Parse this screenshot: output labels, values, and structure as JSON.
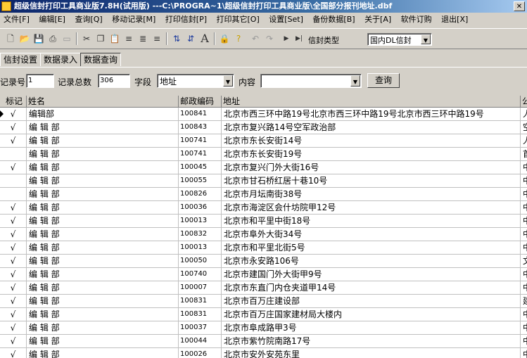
{
  "window": {
    "title": "超级信封打印工具商业版7.8H(试用版)  ---C:\\PROGRA~1\\超级信封打印工具商业版\\全国部分报刊地址.dbf"
  },
  "menu": [
    "文件[F]",
    "编辑[E]",
    "查询[Q]",
    "移动记录[M]",
    "打印信封[P]",
    "打印其它[O]",
    "设置[Set]",
    "备份数据[B]",
    "关于[A]",
    "软件订购",
    "退出[X]"
  ],
  "toolbar": {
    "icons": [
      "new-icon",
      "open-icon",
      "save-icon",
      "print-icon",
      "preview-icon",
      "cut-icon",
      "copy-icon",
      "paste-icon",
      "align-left-icon",
      "align-center-icon",
      "align-right-icon",
      "sort-asc-icon",
      "sort-desc-icon",
      "font-icon",
      "lock-icon",
      "help-icon",
      "undo-icon",
      "redo-icon",
      "next-record-icon",
      "last-record-icon"
    ],
    "envelope_type_label": "信封类型",
    "envelope_type_value": "国内DL信封"
  },
  "tabs": [
    {
      "label": "信封设置",
      "active": false
    },
    {
      "label": "数据录入",
      "active": false
    },
    {
      "label": "数据查询",
      "active": true
    }
  ],
  "filter": {
    "record_no_label": "记录号",
    "record_no_value": "1",
    "record_total_label": "记录总数",
    "record_total_value": "306",
    "field_label": "字段",
    "field_value": "地址",
    "content_label": "内容",
    "content_value": "",
    "query_button": "查询"
  },
  "table": {
    "columns": [
      "标记",
      "姓名",
      "邮政编码",
      "地址",
      "公"
    ],
    "rows": [
      {
        "mark": "√",
        "name": "编辑部",
        "postcode": "100841",
        "address": "北京市西三环中路19号北京市西三环中路19号北京市西三环中路19号",
        "extra": "人"
      },
      {
        "mark": "√",
        "name": "编 辑 部",
        "postcode": "100843",
        "address": "北京市复兴路14号空军政治部",
        "extra": "空"
      },
      {
        "mark": "√",
        "name": "编 辑 部",
        "postcode": "100741",
        "address": "北京市东长安街14号",
        "extra": "人"
      },
      {
        "mark": "",
        "name": "编 辑 部",
        "postcode": "100741",
        "address": "北京市东长安街19号",
        "extra": "首"
      },
      {
        "mark": "√",
        "name": "编 辑 部",
        "postcode": "100045",
        "address": "北京市复兴门外大街16号",
        "extra": "中"
      },
      {
        "mark": "",
        "name": "编 辑 部",
        "postcode": "100055",
        "address": "北京市甘石桥红居十巷10号",
        "extra": "中"
      },
      {
        "mark": "",
        "name": "编 辑 部",
        "postcode": "100826",
        "address": "北京市月坛南街38号",
        "extra": "中"
      },
      {
        "mark": "√",
        "name": "编 辑 部",
        "postcode": "100036",
        "address": "北京市海淀区会什坊院甲12号",
        "extra": "中"
      },
      {
        "mark": "√",
        "name": "编 辑 部",
        "postcode": "100013",
        "address": "北京市和平里中街18号",
        "extra": "中"
      },
      {
        "mark": "√",
        "name": "编 辑 部",
        "postcode": "100832",
        "address": "北京市阜外大街34号",
        "extra": "中"
      },
      {
        "mark": "√",
        "name": "编 辑 部",
        "postcode": "100013",
        "address": "北京市和平里北街5号",
        "extra": "中"
      },
      {
        "mark": "√",
        "name": "编 辑 部",
        "postcode": "100050",
        "address": "北京市永安路106号",
        "extra": "文"
      },
      {
        "mark": "√",
        "name": "编 辑 部",
        "postcode": "100740",
        "address": "北京市建国门外大街甲9号",
        "extra": "中"
      },
      {
        "mark": "√",
        "name": "编 辑 部",
        "postcode": "100007",
        "address": "北京市东直门内仓夹道甲14号",
        "extra": "中"
      },
      {
        "mark": "√",
        "name": "编 辑 部",
        "postcode": "100831",
        "address": "北京市百万庄建设部",
        "extra": "建"
      },
      {
        "mark": "√",
        "name": "编 辑 部",
        "postcode": "100831",
        "address": "北京市百万庄国家建材局大楼内",
        "extra": "中"
      },
      {
        "mark": "√",
        "name": "编 辑 部",
        "postcode": "100037",
        "address": "北京市阜成路甲3号",
        "extra": "中"
      },
      {
        "mark": "√",
        "name": "编 辑 部",
        "postcode": "100044",
        "address": "北京市紫竹院南路17号",
        "extra": "中"
      },
      {
        "mark": "√",
        "name": "编 辑 部",
        "postcode": "100026",
        "address": "北京市安外安苑东里",
        "extra": "中"
      }
    ]
  }
}
